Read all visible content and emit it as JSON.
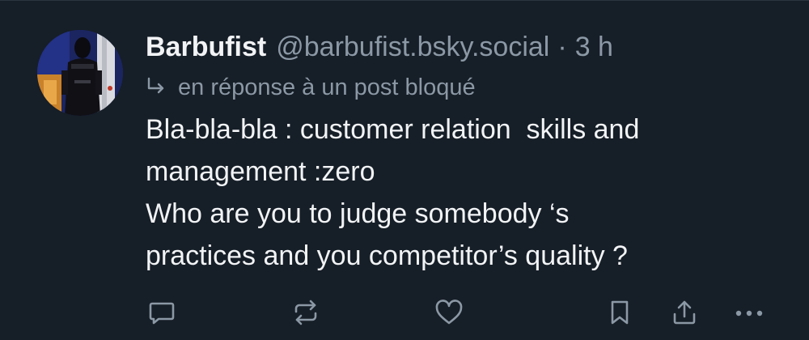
{
  "post": {
    "author": {
      "display_name": "Barbufist",
      "handle": "@barbufist.bsky.social"
    },
    "separator": "·",
    "time": "3 h",
    "reply_context": "en réponse à un post bloqué",
    "text_lines": [
      "Bla-bla-bla : customer relation  skills and",
      "management :zero",
      "Who are you to judge somebody ‘s",
      "practices and you competitor’s quality ?"
    ]
  },
  "actions": [
    {
      "name": "reply",
      "icon": "speech-bubble-icon"
    },
    {
      "name": "repost",
      "icon": "repost-icon"
    },
    {
      "name": "like",
      "icon": "heart-icon"
    },
    {
      "name": "bookmark",
      "icon": "bookmark-icon"
    },
    {
      "name": "share",
      "icon": "share-icon"
    },
    {
      "name": "more",
      "icon": "more-options-icon"
    }
  ],
  "colors": {
    "background": "#161e27",
    "primary_text": "#f1f3f5",
    "secondary_text": "#8b98a5"
  }
}
